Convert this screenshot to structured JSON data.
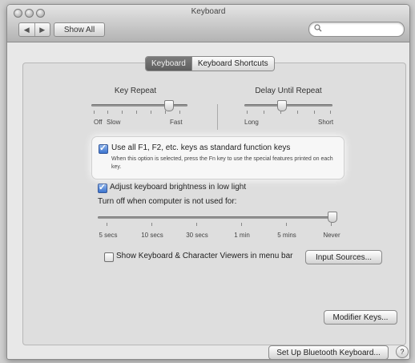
{
  "window": {
    "title": "Keyboard"
  },
  "toolbar": {
    "back_icon": "◀",
    "forward_icon": "▶",
    "show_all_label": "Show All",
    "search_icon": "🔍",
    "search_placeholder": ""
  },
  "tabs": [
    {
      "label": "Keyboard",
      "active": true
    },
    {
      "label": "Keyboard Shortcuts",
      "active": false
    }
  ],
  "key_repeat": {
    "label": "Key Repeat",
    "min_label": "Off",
    "min_label2": "Slow",
    "max_label": "Fast",
    "value": 0.8
  },
  "delay_until_repeat": {
    "label": "Delay Until Repeat",
    "min_label": "Long",
    "max_label": "Short",
    "value": 0.42
  },
  "function_keys": {
    "checked": true,
    "label": "Use all F1, F2, etc. keys as standard function keys",
    "description": "When this option is selected, press the Fn key to use the special features printed on each key."
  },
  "brightness": {
    "checked": true,
    "label": "Adjust keyboard brightness in low light",
    "turn_off_label": "Turn off when computer is not used for:",
    "ticks": [
      "5 secs",
      "10 secs",
      "30 secs",
      "1 min",
      "5 mins",
      "Never"
    ],
    "value": 1.0
  },
  "viewers": {
    "checked": false,
    "label": "Show Keyboard & Character Viewers in menu bar",
    "button": "Input Sources..."
  },
  "buttons": {
    "modifier_keys": "Modifier Keys...",
    "bluetooth": "Set Up Bluetooth Keyboard...",
    "help": "?"
  },
  "colors": {
    "accent": "#3c74cf",
    "active_tab": "#6b6b6b"
  }
}
